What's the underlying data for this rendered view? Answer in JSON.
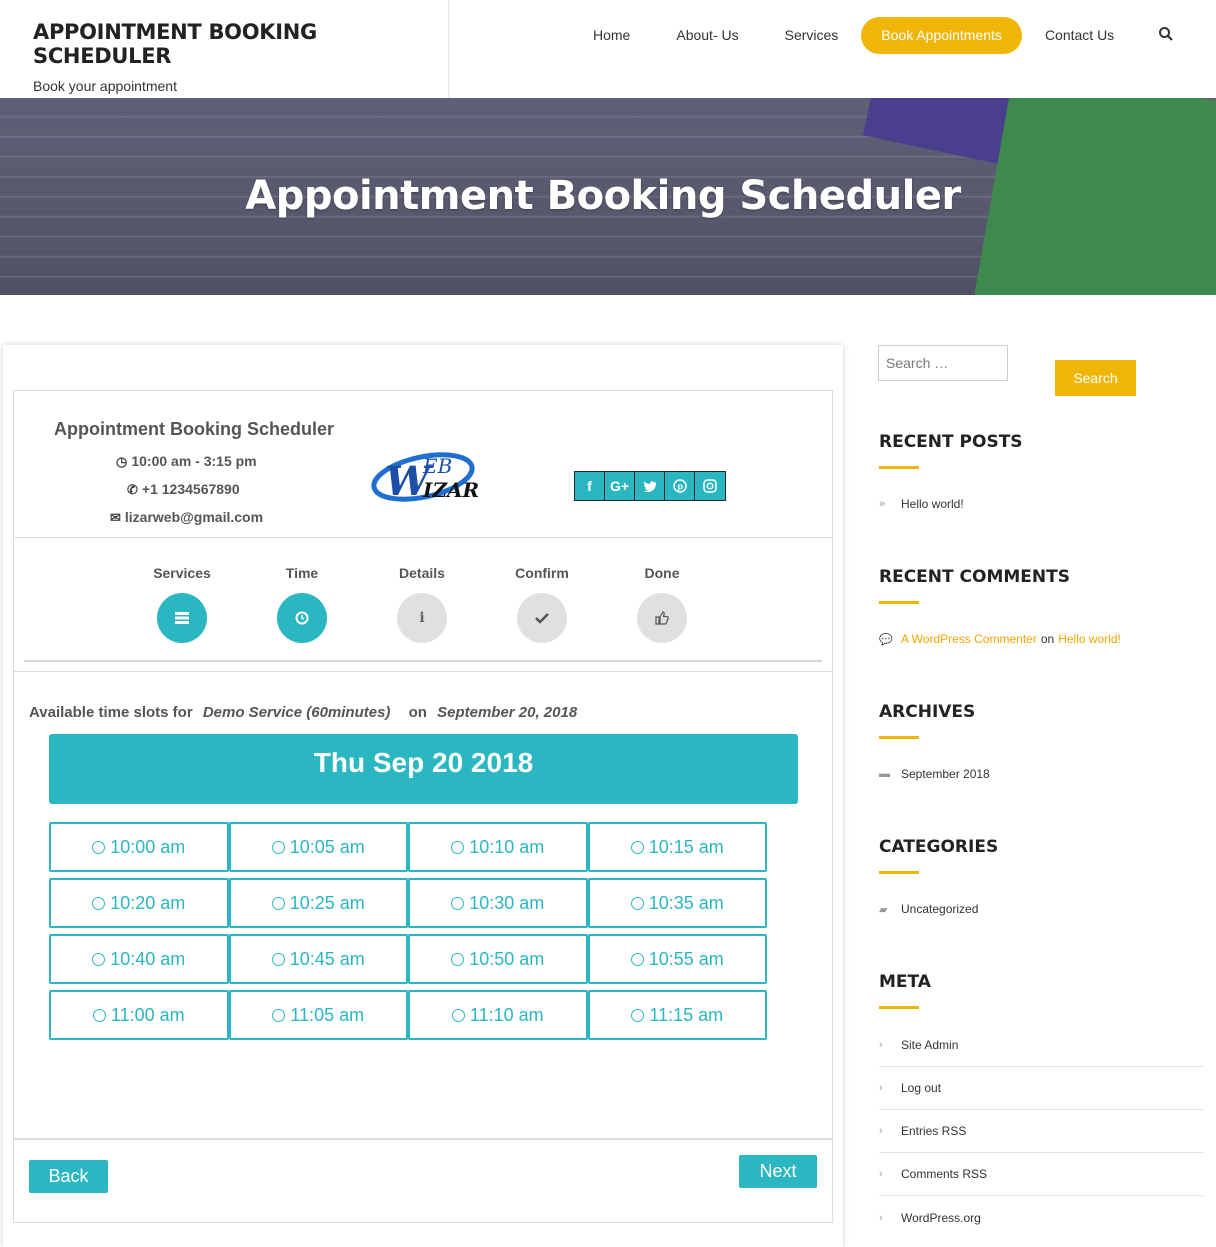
{
  "header": {
    "site_title": "APPOINTMENT BOOKING SCHEDULER",
    "tagline": "Book your appointment",
    "nav": [
      "Home",
      "About- Us",
      "Services",
      "Book Appointments",
      "Contact Us"
    ]
  },
  "hero": {
    "title": "Appointment Booking Scheduler"
  },
  "business": {
    "name": "Appointment Booking Scheduler",
    "hours": "10:00 am - 3:15 pm",
    "phone": "+1 1234567890",
    "email": "lizarweb@gmail.com",
    "logo_text_top": "EB",
    "logo_text_bottom": "IZAR"
  },
  "steps": [
    {
      "label": "Services",
      "state": "done"
    },
    {
      "label": "Time",
      "state": "done"
    },
    {
      "label": "Details",
      "state": "pending"
    },
    {
      "label": "Confirm",
      "state": "pending"
    },
    {
      "label": "Done",
      "state": "pending"
    }
  ],
  "slots": {
    "prefix": "Available time slots for",
    "service": "Demo Service (60minutes)",
    "on": "on",
    "date": "September 20, 2018",
    "date_heading": "Thu Sep 20 2018",
    "times": [
      "10:00 am",
      "10:05 am",
      "10:10 am",
      "10:15 am",
      "10:20 am",
      "10:25 am",
      "10:30 am",
      "10:35 am",
      "10:40 am",
      "10:45 am",
      "10:50 am",
      "10:55 am",
      "11:00 am",
      "11:05 am",
      "11:10 am",
      "11:15 am"
    ]
  },
  "buttons": {
    "back": "Back",
    "next": "Next"
  },
  "sidebar": {
    "search_placeholder": "Search …",
    "search_button": "Search",
    "recent_posts_title": "RECENT POSTS",
    "recent_posts": [
      "Hello world!"
    ],
    "recent_comments_title": "RECENT COMMENTS",
    "comment_author": "A WordPress Commenter",
    "comment_on": "on",
    "comment_post": "Hello world!",
    "archives_title": "ARCHIVES",
    "archives": [
      "September 2018"
    ],
    "categories_title": "CATEGORIES",
    "categories": [
      "Uncategorized"
    ],
    "meta_title": "META",
    "meta": [
      "Site Admin",
      "Log out",
      "Entries RSS",
      "Comments RSS",
      "WordPress.org"
    ]
  },
  "colors": {
    "accent": "#f0b607",
    "teal": "#2ab7c2"
  }
}
